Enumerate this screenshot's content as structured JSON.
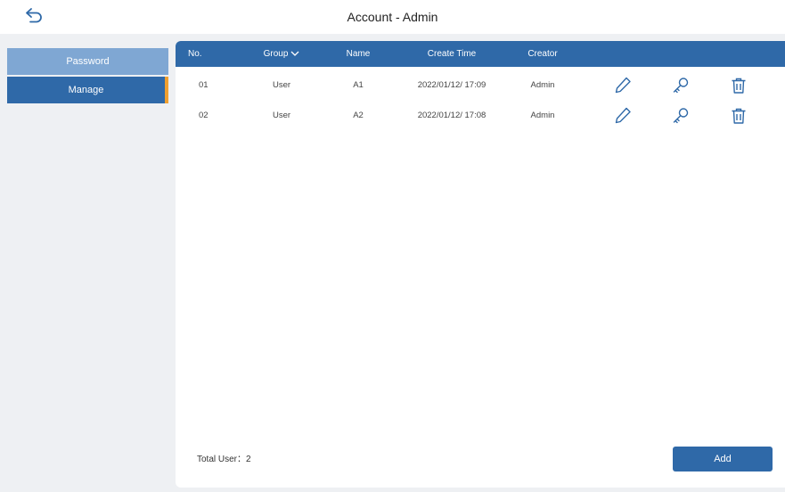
{
  "header": {
    "title": "Account - Admin",
    "back_icon": "back-arrow-icon"
  },
  "sidebar": {
    "items": [
      {
        "label": "Password",
        "active": false
      },
      {
        "label": "Manage",
        "active": true
      }
    ]
  },
  "table": {
    "columns": {
      "no": "No.",
      "group": "Group",
      "name": "Name",
      "create_time": "Create Time",
      "creator": "Creator"
    },
    "rows": [
      {
        "no": "01",
        "group": "User",
        "name": "A1",
        "create_time": "2022/01/12/ 17:09",
        "creator": "Admin"
      },
      {
        "no": "02",
        "group": "User",
        "name": "A2",
        "create_time": "2022/01/12/ 17:08",
        "creator": "Admin"
      }
    ],
    "row_actions": [
      "edit-icon",
      "key-icon",
      "delete-icon"
    ]
  },
  "footer": {
    "total_label": "Total User：2",
    "add_label": "Add"
  },
  "colors": {
    "accent": "#2f69a8",
    "sidebar_inactive": "#7fa7d3",
    "active_marker": "#f0a030",
    "background": "#eef0f3"
  }
}
